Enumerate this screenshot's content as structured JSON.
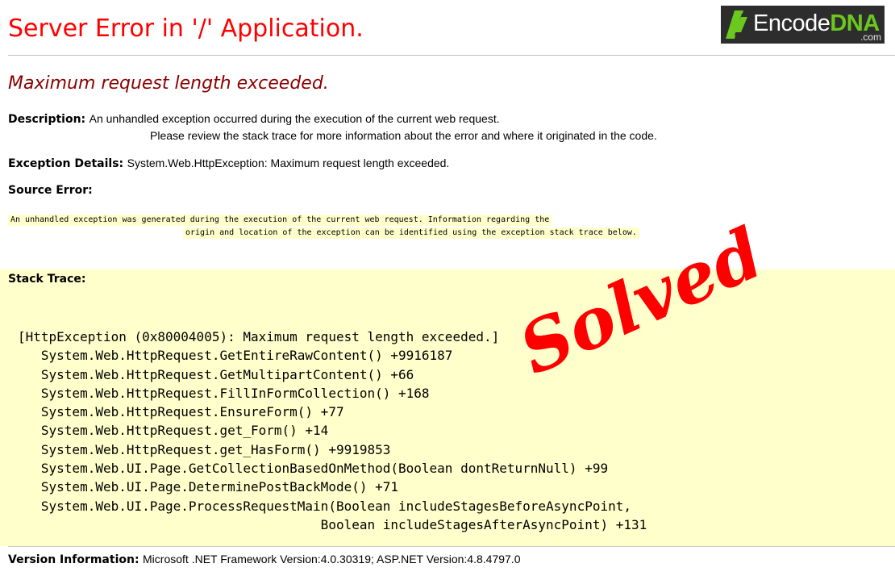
{
  "header": {
    "title": "Server Error in '/' Application.",
    "logo": {
      "text_main": "Encode",
      "text_accent": "DNA",
      "tld": ".com"
    }
  },
  "error": {
    "message": "Maximum request length exceeded.",
    "description_label": "Description:",
    "description_line1": "An unhandled exception occurred during the execution of the current web request.",
    "description_line2": "Please review the stack trace for more information about the error and where it originated in the code.",
    "exception_label": "Exception Details:",
    "exception_value": "System.Web.HttpException: Maximum request length exceeded.",
    "source_error_label": "Source Error:",
    "source_error_line1": "An unhandled exception was generated during the execution of the current web request. Information regarding the",
    "source_error_line2": "origin and location of the exception can be identified using the exception stack trace below.",
    "stack_trace_label": "Stack Trace:",
    "stack_trace": "[HttpException (0x80004005): Maximum request length exceeded.]\n   System.Web.HttpRequest.GetEntireRawContent() +9916187\n   System.Web.HttpRequest.GetMultipartContent() +66\n   System.Web.HttpRequest.FillInFormCollection() +168\n   System.Web.HttpRequest.EnsureForm() +77\n   System.Web.HttpRequest.get_Form() +14\n   System.Web.HttpRequest.get_HasForm() +9919853\n   System.Web.UI.Page.GetCollectionBasedOnMethod(Boolean dontReturnNull) +99\n   System.Web.UI.Page.DeterminePostBackMode() +71\n   System.Web.UI.Page.ProcessRequestMain(Boolean includeStagesBeforeAsyncPoint,\n                                       Boolean includeStagesAfterAsyncPoint) +131",
    "version_label": "Version Information:",
    "version_value": "Microsoft .NET Framework Version:4.0.30319; ASP.NET Version:4.8.4797.0"
  },
  "overlay": {
    "stamp_text": "Solved"
  },
  "colors": {
    "title": "#ff0000",
    "subtitle": "#8b0000",
    "panel_background": "#ffffcc",
    "logo_background": "#2d2d2d",
    "logo_accent": "#6ac81f",
    "stamp": "#ff0000"
  }
}
